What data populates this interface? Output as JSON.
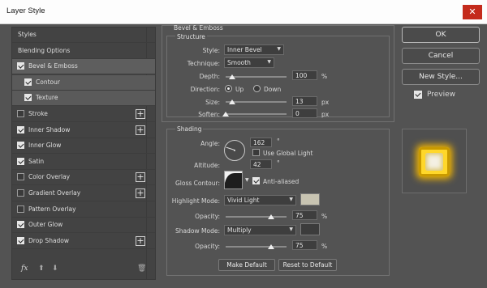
{
  "window": {
    "title": "Layer Style",
    "close_glyph": "✕"
  },
  "left_panel": {
    "items": [
      {
        "label": "Styles",
        "has_checkbox": false,
        "checked": false,
        "has_plus": false,
        "state": "normal",
        "indent": 0
      },
      {
        "label": "Blending Options",
        "has_checkbox": false,
        "checked": false,
        "has_plus": false,
        "state": "normal",
        "indent": 0
      },
      {
        "label": "Bevel & Emboss",
        "has_checkbox": true,
        "checked": true,
        "has_plus": false,
        "state": "active",
        "indent": 0
      },
      {
        "label": "Contour",
        "has_checkbox": true,
        "checked": true,
        "has_plus": false,
        "state": "sub",
        "indent": 1
      },
      {
        "label": "Texture",
        "has_checkbox": true,
        "checked": true,
        "has_plus": false,
        "state": "sub",
        "indent": 1
      },
      {
        "label": "Stroke",
        "has_checkbox": true,
        "checked": false,
        "has_plus": true,
        "state": "normal",
        "indent": 0
      },
      {
        "label": "Inner Shadow",
        "has_checkbox": true,
        "checked": true,
        "has_plus": true,
        "state": "normal",
        "indent": 0
      },
      {
        "label": "Inner Glow",
        "has_checkbox": true,
        "checked": true,
        "has_plus": false,
        "state": "normal",
        "indent": 0
      },
      {
        "label": "Satin",
        "has_checkbox": true,
        "checked": true,
        "has_plus": false,
        "state": "normal",
        "indent": 0
      },
      {
        "label": "Color Overlay",
        "has_checkbox": true,
        "checked": false,
        "has_plus": true,
        "state": "normal",
        "indent": 0
      },
      {
        "label": "Gradient Overlay",
        "has_checkbox": true,
        "checked": false,
        "has_plus": true,
        "state": "normal",
        "indent": 0
      },
      {
        "label": "Pattern Overlay",
        "has_checkbox": true,
        "checked": false,
        "has_plus": false,
        "state": "normal",
        "indent": 0
      },
      {
        "label": "Outer Glow",
        "has_checkbox": true,
        "checked": true,
        "has_plus": false,
        "state": "normal",
        "indent": 0
      },
      {
        "label": "Drop Shadow",
        "has_checkbox": true,
        "checked": true,
        "has_plus": true,
        "state": "normal",
        "indent": 0
      }
    ],
    "footer": {
      "fx_label": "fx",
      "up_glyph": "⬆",
      "down_glyph": "⬇",
      "trash_glyph": "🗑"
    },
    "plus_glyph": "+"
  },
  "bevel": {
    "header": "Bevel & Emboss",
    "structure_title": "Structure",
    "style_label": "Style:",
    "style_value": "Inner Bevel",
    "technique_label": "Technique:",
    "technique_value": "Smooth",
    "depth_label": "Depth:",
    "depth_value": "100",
    "depth_unit": "%",
    "depth_fraction": 0.1,
    "direction_label": "Direction:",
    "direction_up": "Up",
    "direction_down": "Down",
    "direction_selected": "Up",
    "size_label": "Size:",
    "size_value": "13",
    "size_unit": "px",
    "size_fraction": 0.1,
    "soften_label": "Soften:",
    "soften_value": "0",
    "soften_unit": "px",
    "soften_fraction": 0.0
  },
  "shading": {
    "title": "Shading",
    "angle_label": "Angle:",
    "angle_value": "162",
    "angle_unit": "°",
    "angle_degrees": 162,
    "global_light_label": "Use Global Light",
    "global_light_checked": false,
    "altitude_label": "Altitude:",
    "altitude_value": "42",
    "altitude_unit": "°",
    "gloss_label": "Gloss Contour:",
    "anti_aliased_label": "Anti-aliased",
    "anti_aliased_checked": true,
    "highlight_label": "Highlight Mode:",
    "highlight_value": "Vivid Light",
    "highlight_color": "#c8c4b2",
    "highlight_opacity_label": "Opacity:",
    "highlight_opacity_value": "75",
    "highlight_opacity_unit": "%",
    "highlight_opacity_fraction": 0.75,
    "shadow_label": "Shadow Mode:",
    "shadow_value": "Multiply",
    "shadow_color": "#3c3c3c",
    "shadow_opacity_label": "Opacity:",
    "shadow_opacity_value": "75",
    "shadow_opacity_unit": "%",
    "shadow_opacity_fraction": 0.75
  },
  "bottom_buttons": {
    "make_default": "Make Default",
    "reset_default": "Reset to Default"
  },
  "right": {
    "ok": "OK",
    "cancel": "Cancel",
    "new_style": "New Style...",
    "preview_label": "Preview",
    "preview_checked": true
  },
  "colors": {
    "panel_bg": "#535353",
    "list_bg": "#434343",
    "accent_gold": "#ffd72a",
    "close_red": "#c42b1c"
  }
}
